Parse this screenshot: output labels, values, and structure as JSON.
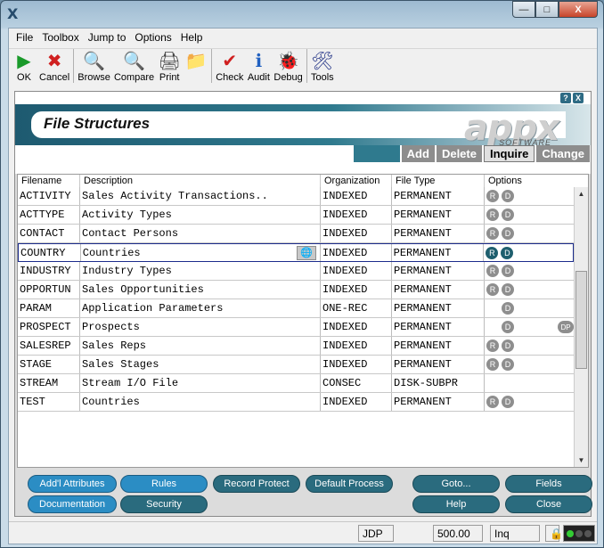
{
  "window": {
    "app_icon": "X",
    "buttons": [
      "—",
      "□",
      "X"
    ]
  },
  "menu": [
    "File",
    "Toolbox",
    "Jump to",
    "Options",
    "Help"
  ],
  "toolbar": [
    {
      "label": "OK",
      "icon": "play-icon",
      "glyph": "▶",
      "color": "#1a9a2a"
    },
    {
      "label": "Cancel",
      "icon": "cancel-icon",
      "glyph": "✖",
      "color": "#d02020"
    },
    {
      "label": "Browse",
      "icon": "browse-icon",
      "glyph": "🔍",
      "color": "#3a6aa0"
    },
    {
      "label": "Compare",
      "icon": "compare-icon",
      "glyph": "🔍",
      "color": "#3a6aa0"
    },
    {
      "label": "Print",
      "icon": "print-icon",
      "glyph": "🖨",
      "color": "#444"
    },
    {
      "label": "",
      "icon": "folder-icon",
      "glyph": "📁",
      "color": "#c08a20"
    },
    {
      "label": "Check",
      "icon": "check-icon",
      "glyph": "✔",
      "color": "#d02020"
    },
    {
      "label": "Audit",
      "icon": "audit-icon",
      "glyph": "ℹ",
      "color": "#2060c0"
    },
    {
      "label": "Debug",
      "icon": "debug-icon",
      "glyph": "🐞",
      "color": "#2a6a4a"
    },
    {
      "label": "Tools",
      "icon": "tools-icon",
      "glyph": "🛠",
      "color": "#2a3a8a"
    }
  ],
  "panel": {
    "help_icons": [
      "?",
      "X"
    ],
    "title": "File Structures",
    "logo": "appx",
    "logo_sub": "SOFTWARE",
    "tabs": [
      "Add",
      "Delete",
      "Inquire",
      "Change"
    ]
  },
  "grid": {
    "headers": [
      "Filename",
      "Description",
      "Organization",
      "File Type",
      "Options"
    ],
    "rows": [
      {
        "name": "ACTIVITY",
        "desc": "Sales Activity Transactions..",
        "org": "INDEXED",
        "type": "PERMANENT",
        "opts": [
          "R",
          "D"
        ]
      },
      {
        "name": "ACTTYPE",
        "desc": "Activity Types",
        "org": "INDEXED",
        "type": "PERMANENT",
        "opts": [
          "R",
          "D"
        ]
      },
      {
        "name": "CONTACT",
        "desc": "Contact Persons",
        "org": "INDEXED",
        "type": "PERMANENT",
        "opts": [
          "R",
          "D"
        ]
      },
      {
        "name": "COUNTRY",
        "desc": "Countries",
        "org": "INDEXED",
        "type": "PERMANENT",
        "opts": [
          "R",
          "D"
        ]
      },
      {
        "name": "INDUSTRY",
        "desc": "Industry Types",
        "org": "INDEXED",
        "type": "PERMANENT",
        "opts": [
          "R",
          "D"
        ]
      },
      {
        "name": "OPPORTUN",
        "desc": "Sales Opportunities",
        "org": "INDEXED",
        "type": "PERMANENT",
        "opts": [
          "R",
          "D"
        ]
      },
      {
        "name": "PARAM",
        "desc": "Application Parameters",
        "org": "ONE-REC",
        "type": "PERMANENT",
        "opts": [
          "D"
        ]
      },
      {
        "name": "PROSPECT",
        "desc": "Prospects",
        "org": "INDEXED",
        "type": "PERMANENT",
        "opts": [
          "D"
        ],
        "extra": "DP"
      },
      {
        "name": "SALESREP",
        "desc": "Sales Reps",
        "org": "INDEXED",
        "type": "PERMANENT",
        "opts": [
          "R",
          "D"
        ]
      },
      {
        "name": "STAGE",
        "desc": "Sales Stages",
        "org": "INDEXED",
        "type": "PERMANENT",
        "opts": [
          "R",
          "D"
        ]
      },
      {
        "name": "STREAM",
        "desc": "Stream I/O File",
        "org": "CONSEC",
        "type": "DISK-SUBPR",
        "opts": []
      },
      {
        "name": "TEST",
        "desc": "Countries",
        "org": "INDEXED",
        "type": "PERMANENT",
        "opts": [
          "R",
          "D"
        ]
      }
    ]
  },
  "buttons": {
    "attributes": "Add'l Attributes",
    "rules": "Rules",
    "record_protect": "Record Protect",
    "default_process": "Default Process",
    "goto": "Goto...",
    "fields": "Fields",
    "documentation": "Documentation",
    "security": "Security",
    "help": "Help",
    "close": "Close"
  },
  "status": {
    "user": "JDP",
    "value": "500.00",
    "mode": "Inq"
  }
}
